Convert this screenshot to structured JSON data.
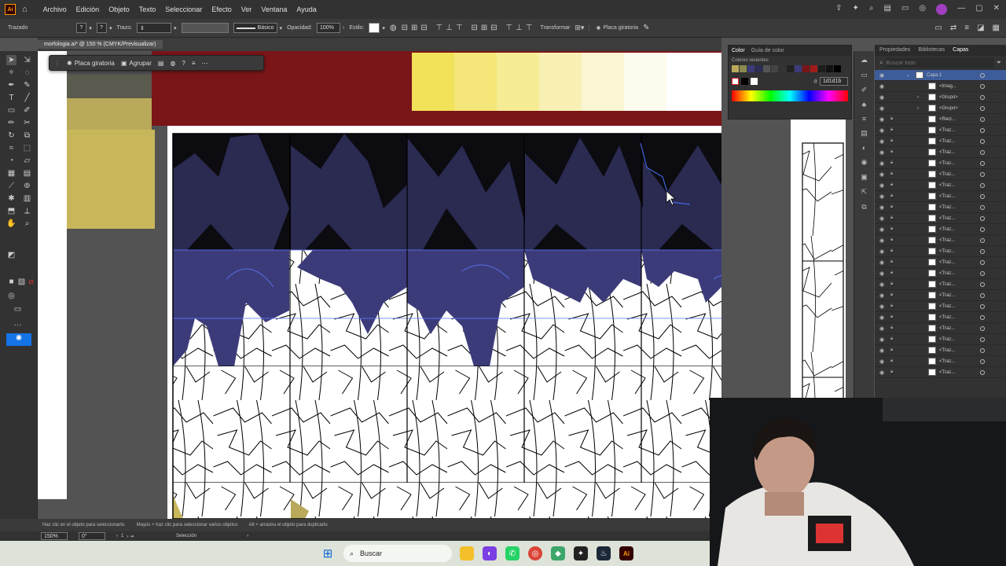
{
  "menubar": {
    "logo": "Ai",
    "items": [
      "Archivo",
      "Edición",
      "Objeto",
      "Texto",
      "Seleccionar",
      "Efecto",
      "Ver",
      "Ventana",
      "Ayuda"
    ]
  },
  "control": {
    "object_type": "Trazado",
    "stroke_label": "Trazo:",
    "brush_style": "Básico",
    "opacity_label": "Opacidad:",
    "opacity_value": "100%",
    "style_label": "Estilo:",
    "transform_label": "Transformar",
    "repeat_label": "Placa giratoria"
  },
  "document": {
    "tab_title": "morfologia.ai* @ 150 % (CMYK/Previsualizar)"
  },
  "context_bar": {
    "repeat_label": "Placa giratoria",
    "group_label": "Agrupar"
  },
  "color_panel": {
    "tab_color": "Color",
    "tab_guide": "Guía de color",
    "recent_label": "Colores recientes",
    "hex_value": "1d1d1b"
  },
  "layers_panel": {
    "tab_properties": "Propiedades",
    "tab_libraries": "Bibliotecas",
    "tab_layers": "Capas",
    "search_placeholder": "Buscar todo",
    "layer_name": "Capa 1",
    "rows": [
      "<Imag...",
      "<Grupo>",
      "<Grupo>",
      "<Rect...",
      "<Traz...",
      "<Traz...",
      "<Traz...",
      "<Traz...",
      "<Traz...",
      "<Traz...",
      "<Traz...",
      "<Traz...",
      "<Traz...",
      "<Traz...",
      "<Traz...",
      "<Traz...",
      "<Traz...",
      "<Traz...",
      "<Traz...",
      "<Traz...",
      "<Traz...",
      "<Traz...",
      "<Traz...",
      "<Traz...",
      "<Traz...",
      "<Traz...",
      "<Traz..."
    ]
  },
  "status": {
    "hint1": "Haz clic en el objeto para seleccionarlo.",
    "hint2": "Mayús + haz clic para seleccionar varios objetos",
    "hint3": "Alt + arrastra el objeto para duplicarlo.",
    "zoom": "150%",
    "rotation": "0°",
    "artboard": "1",
    "mode": "Selección"
  },
  "taskbar": {
    "search_placeholder": "Buscar"
  },
  "colors": {
    "accent": "#3c3b7a",
    "maroon": "#7a1518",
    "olive": "#c8b75a",
    "dark": "#0b0b10"
  }
}
